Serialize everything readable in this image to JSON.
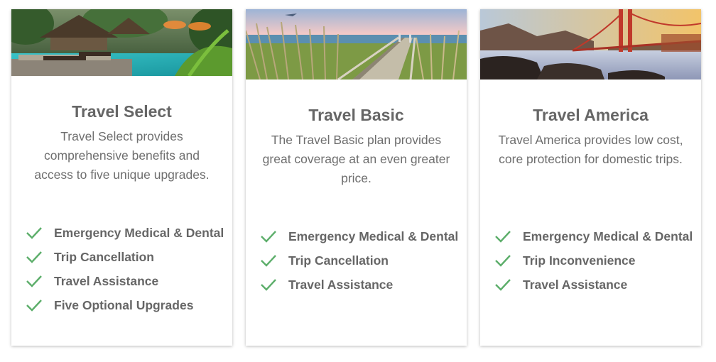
{
  "colors": {
    "check": "#5cae6a",
    "title": "#666666",
    "text": "#6e6e6e"
  },
  "cards": [
    {
      "image": "tropical-resort-pool-image",
      "title": "Travel Select",
      "description": "Travel Select provides comprehensive benefits and access to five unique upgrades.",
      "features": [
        "Emergency Medical & Dental",
        "Trip Cancellation",
        "Travel Assistance",
        "Five Optional Upgrades"
      ]
    },
    {
      "image": "beach-boardwalk-image",
      "title": "Travel Basic",
      "description": "The Travel Basic plan provides great coverage at an even greater price.",
      "features": [
        "Emergency Medical & Dental",
        "Trip Cancellation",
        "Travel Assistance"
      ]
    },
    {
      "image": "golden-gate-bridge-image",
      "title": "Travel America",
      "description": "Travel America provides low cost, core protection for domestic trips.",
      "features": [
        "Emergency Medical & Dental",
        "Trip Inconvenience",
        "Travel Assistance"
      ]
    }
  ]
}
